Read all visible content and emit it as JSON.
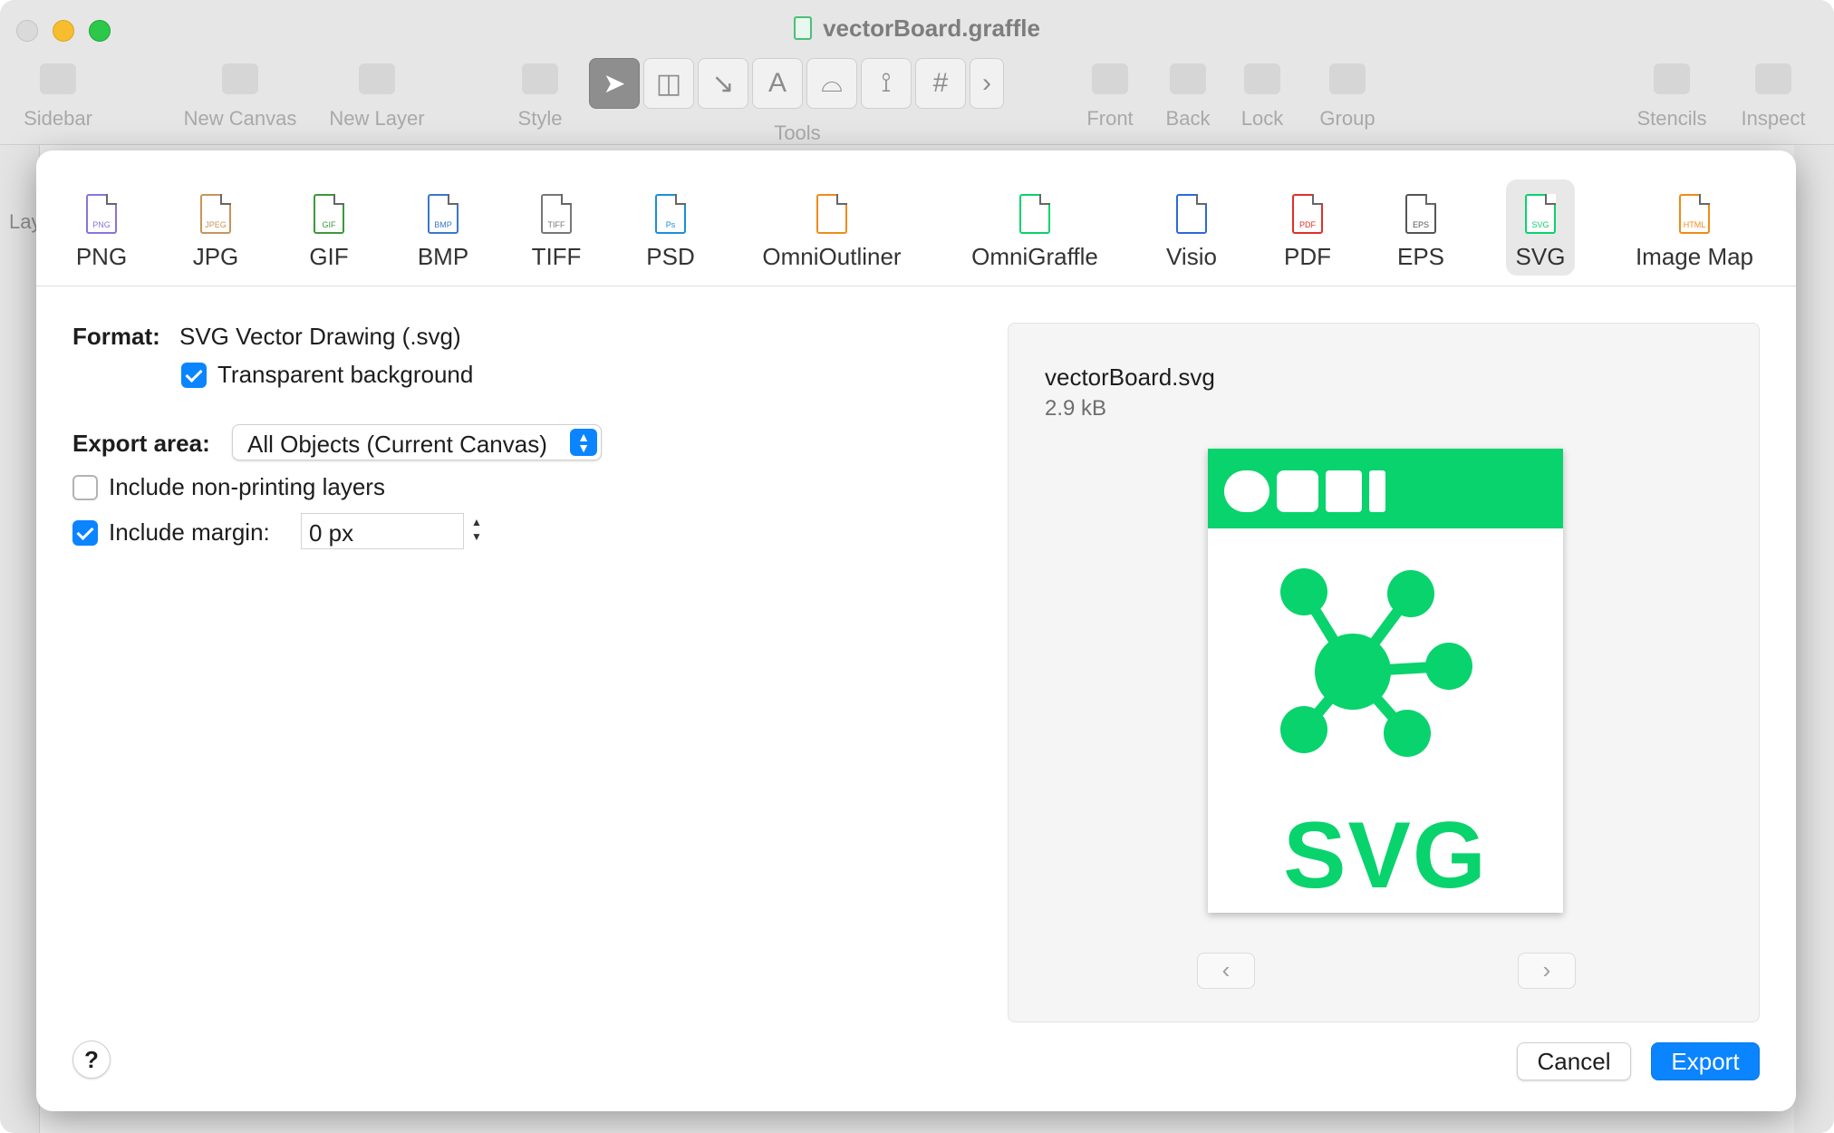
{
  "window": {
    "title": "vectorBoard.graffle",
    "toolbar": {
      "sidebar": "Sidebar",
      "new_canvas": "New Canvas",
      "new_layer": "New Layer",
      "style": "Style",
      "tools": "Tools",
      "front": "Front",
      "back": "Back",
      "lock": "Lock",
      "group": "Group",
      "stencils": "Stencils",
      "inspect": "Inspect"
    },
    "sidebar_label": "Lay"
  },
  "dialog": {
    "formats": [
      {
        "label": "PNG",
        "tag": "PNG",
        "color": "#8a74d8"
      },
      {
        "label": "JPG",
        "tag": "JPEG",
        "color": "#c8945a"
      },
      {
        "label": "GIF",
        "tag": "GIF",
        "color": "#3a9a3a"
      },
      {
        "label": "BMP",
        "tag": "BMP",
        "color": "#3a78c8"
      },
      {
        "label": "TIFF",
        "tag": "TIFF",
        "color": "#777777"
      },
      {
        "label": "PSD",
        "tag": "Ps",
        "color": "#1a8fd8"
      },
      {
        "label": "OmniOutliner",
        "tag": "",
        "color": "#f08a1a"
      },
      {
        "label": "OmniGraffle",
        "tag": "",
        "color": "#09d36c"
      },
      {
        "label": "Visio",
        "tag": "",
        "color": "#2a6ad8"
      },
      {
        "label": "PDF",
        "tag": "PDF",
        "color": "#e0302a"
      },
      {
        "label": "EPS",
        "tag": "EPS",
        "color": "#555555"
      },
      {
        "label": "SVG",
        "tag": "SVG",
        "color": "#09d36c"
      },
      {
        "label": "Image Map",
        "tag": "HTML",
        "color": "#f08a1a"
      }
    ],
    "selected_format": "SVG",
    "format_label": "Format:",
    "format_value": "SVG Vector Drawing (.svg)",
    "transparent_background": {
      "label": "Transparent background",
      "checked": true
    },
    "export_area_label": "Export area:",
    "export_area_value": "All Objects (Current Canvas)",
    "include_nonprinting": {
      "label": "Include non-printing layers",
      "checked": false
    },
    "include_margin": {
      "label": "Include margin:",
      "checked": true,
      "value": "0 px"
    },
    "preview": {
      "filename": "vectorBoard.svg",
      "filesize": "2.9 kB",
      "badge_text": "SVG",
      "accent": "#09d36c"
    },
    "buttons": {
      "help": "?",
      "cancel": "Cancel",
      "export": "Export",
      "prev": "‹",
      "next": "›"
    },
    "accent_blue": "#0a84ff"
  }
}
